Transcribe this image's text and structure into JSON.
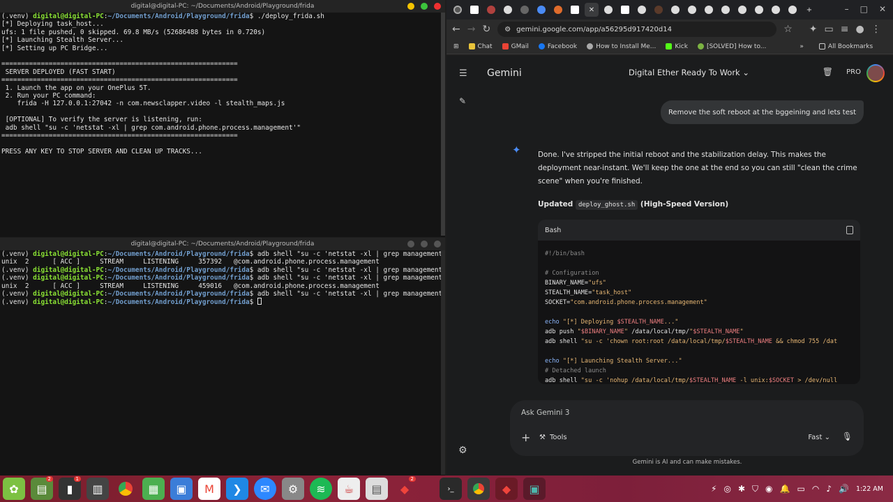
{
  "terminal_top": {
    "title": "digital@digital-PC: ~/Documents/Android/Playground/frida",
    "prompt_user": "digital@digital-PC",
    "prompt_path": "~/Documents/Android/Playground/frida",
    "venv": "(.venv) ",
    "command": "./deploy_frida.sh",
    "output": [
      "[*] Deploying task_host...",
      "ufs: 1 file pushed, 0 skipped. 69.8 MB/s (52686488 bytes in 0.720s)",
      "[*] Launching Stealth Server...",
      "[*] Setting up PC Bridge...",
      "",
      "============================================================",
      " SERVER DEPLOYED (FAST START)",
      "============================================================",
      " 1. Launch the app on your OnePlus 5T.",
      " 2. Run your PC command:",
      "    frida -H 127.0.0.1:27042 -n com.newsclapper.video -l stealth_maps.js",
      "",
      " [OPTIONAL] To verify the server is listening, run:",
      " adb shell \"su -c 'netstat -xl | grep com.android.phone.process.management'\"",
      "============================================================",
      "",
      "PRESS ANY KEY TO STOP SERVER AND CLEAN UP TRACKS..."
    ]
  },
  "terminal_bottom": {
    "title": "digital@digital-PC: ~/Documents/Android/Playground/frida",
    "lines": [
      {
        "type": "prompt",
        "cmd": "adb shell \"su -c 'netstat -xl | grep management'\""
      },
      {
        "type": "out",
        "text": "unix  2      [ ACC ]     STREAM     LISTENING     357392   @com.android.phone.process.management"
      },
      {
        "type": "prompt",
        "cmd": "adb shell \"su -c 'netstat -xl | grep management'\""
      },
      {
        "type": "prompt",
        "cmd": "adb shell \"su -c 'netstat -xl | grep management'\""
      },
      {
        "type": "out",
        "text": "unix  2      [ ACC ]     STREAM     LISTENING     459016   @com.android.phone.process.management"
      },
      {
        "type": "prompt",
        "cmd": "adb shell \"su -c 'netstat -xl | grep management'\""
      },
      {
        "type": "prompt",
        "cmd": ""
      }
    ]
  },
  "browser": {
    "url": "gemini.google.com/app/a56295d917420d14",
    "bookmarks": [
      "Chat",
      "GMail",
      "Facebook",
      "How to Install Me...",
      "Kick",
      "[SOLVED] How to..."
    ],
    "all_bookmarks": "All Bookmarks"
  },
  "gemini": {
    "brand": "Gemini",
    "chat_title": "Digital Ether Ready To Work",
    "pro_label": "PRO",
    "user_message": "Remove the soft reboot at the bggeining and lets test",
    "response_text": "Done. I've stripped the initial reboot and the stabilization delay. This makes the deployment near-instant. We'll keep the one at the end so you can still \"clean the crime scene\" when you're finished.",
    "updated_prefix": "Updated",
    "updated_file": "deploy_ghost.sh",
    "updated_suffix": "(High-Speed Version)",
    "code_lang": "Bash",
    "code_lines": [
      "#!/bin/bash",
      "",
      "# Configuration",
      "BINARY_NAME=\"ufs\"",
      "STEALTH_NAME=\"task_host\"",
      "SOCKET=\"com.android.phone.process.management\"",
      "",
      "echo \"[*] Deploying $STEALTH_NAME...\"",
      "adb push \"$BINARY_NAME\" /data/local/tmp/\"$STEALTH_NAME\"",
      "adb shell \"su -c 'chown root:root /data/local/tmp/$STEALTH_NAME && chmod 755 /dat",
      "",
      "echo \"[*] Launching Stealth Server...\"",
      "# Detached launch",
      "adb shell \"su -c 'nohup /data/local/tmp/$STEALTH_NAME -l unix:$SOCKET > /dev/null"
    ],
    "input_placeholder": "Ask Gemini 3",
    "tools_label": "Tools",
    "mode_label": "Fast",
    "disclaimer": "Gemini is AI and can make mistakes."
  },
  "taskbar": {
    "clock": "1:22 AM",
    "badges": [
      "2",
      "1",
      "2"
    ]
  }
}
